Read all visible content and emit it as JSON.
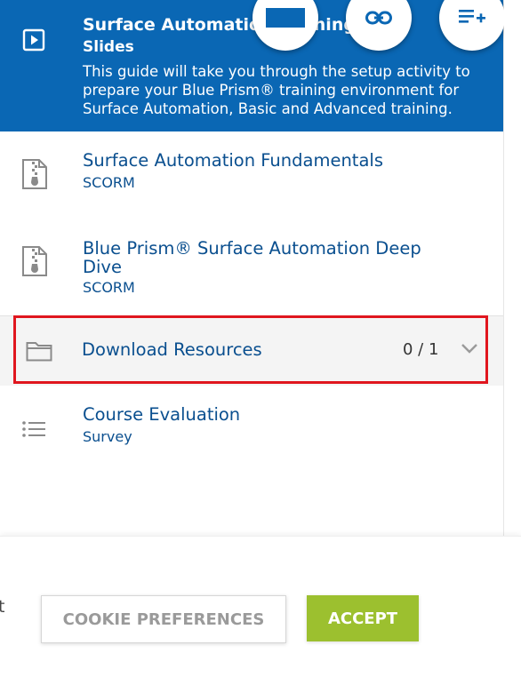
{
  "active_module": {
    "title": "Surface Automation Training (EN)",
    "type": "Slides",
    "description": "This guide will take you through the setup activity to prepare your Blue Prism® training environment for Surface Automation, Basic and Advanced training."
  },
  "fab_icons": [
    "rectangle-icon",
    "link-icon",
    "add-to-playlist-icon"
  ],
  "modules": [
    {
      "title": "Surface Automation Fundamentals",
      "type": "SCORM",
      "icon": "zip-file-icon"
    },
    {
      "title": "Blue Prism® Surface Automation Deep Dive",
      "type": "SCORM",
      "icon": "zip-file-icon"
    }
  ],
  "section": {
    "title": "Download Resources",
    "progress": "0 / 1",
    "icon": "folder-icon"
  },
  "evaluation": {
    "title": "Course Evaluation",
    "type": "Survey",
    "icon": "list-icon"
  },
  "cookie_banner": {
    "edge_text": "t",
    "preferences_label": "COOKIE PREFERENCES",
    "accept_label": "ACCEPT"
  },
  "colors": {
    "active_bg": "#0a67b4",
    "link": "#0a4f8f",
    "accept": "#9cc02f",
    "highlight": "#e0161e"
  }
}
